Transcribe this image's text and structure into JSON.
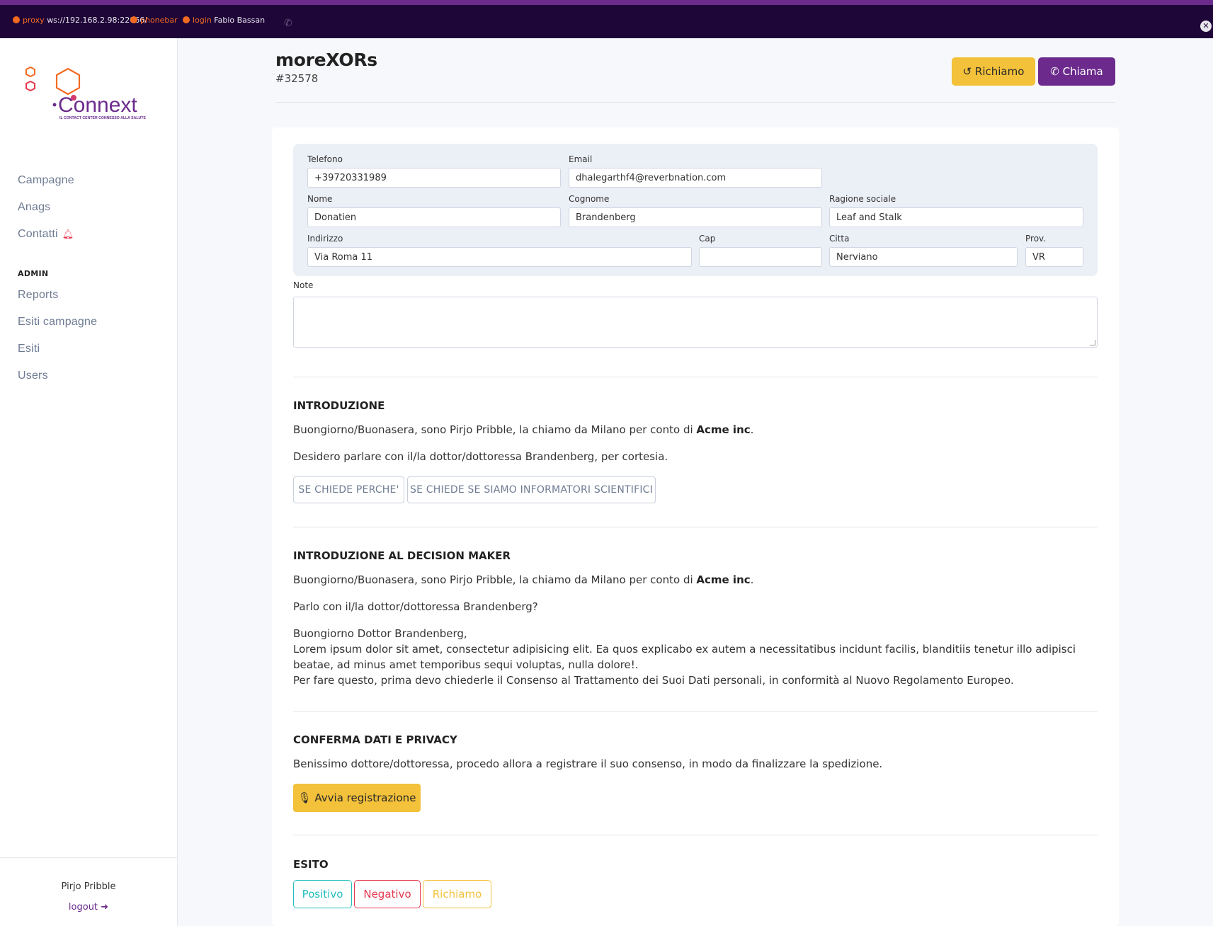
{
  "topbar": {
    "proxy_label": "proxy",
    "proxy_value": "ws://192.168.2.98:22066/",
    "phonebar_label": "phonebar",
    "login_label": "login",
    "login_user": "Fabio Bassan"
  },
  "logo": {
    "brand": "Connext",
    "tagline": "IL CONTACT CENTER CONNESSO ALLA SALUTE"
  },
  "sidebar": {
    "items": [
      {
        "label": "Campagne"
      },
      {
        "label": "Anags"
      },
      {
        "label": "Contatti"
      }
    ],
    "admin_heading": "ADMIN",
    "admin_items": [
      {
        "label": "Reports"
      },
      {
        "label": "Esiti campagne"
      },
      {
        "label": "Esiti"
      },
      {
        "label": "Users"
      }
    ],
    "user_name": "Pirjo Pribble",
    "logout_label": "logout"
  },
  "header": {
    "title": "moreXORs",
    "id": "#32578",
    "richiamo_label": "Richiamo",
    "chiama_label": "Chiama"
  },
  "form": {
    "telefono_label": "Telefono",
    "telefono_value": "+39720331989",
    "email_label": "Email",
    "email_value": "dhalegarthf4@reverbnation.com",
    "nome_label": "Nome",
    "nome_value": "Donatien",
    "cognome_label": "Cognome",
    "cognome_value": "Brandenberg",
    "ragione_label": "Ragione sociale",
    "ragione_value": "Leaf and Stalk",
    "indirizzo_label": "Indirizzo",
    "indirizzo_value": "Via Roma 11",
    "cap_label": "Cap",
    "cap_value": "",
    "citta_label": "Citta",
    "citta_value": "Nerviano",
    "prov_label": "Prov.",
    "prov_value": "VR",
    "note_label": "Note",
    "note_value": ""
  },
  "script": {
    "intro_title": "INTRODUZIONE",
    "intro_p1_pre": "Buongiorno/Buonasera, sono Pirjo Pribble, la chiamo da Milano per conto di ",
    "intro_p1_company": "Acme inc",
    "intro_p2": "Desidero parlare con il/la dottor/dottoressa Brandenberg, per cortesia.",
    "btn_perche": "SE CHIEDE PERCHE'",
    "btn_informatori": "SE CHIEDE SE SIAMO INFORMATORI SCIENTIFICI",
    "dm_title": "INTRODUZIONE AL DECISION MAKER",
    "dm_p1_pre": "Buongiorno/Buonasera, sono Pirjo Pribble, la chiamo da Milano per conto di ",
    "dm_p1_company": "Acme inc",
    "dm_p2": "Parlo con il/la dottor/dottoressa Brandenberg?",
    "dm_p3_l1": "Buongiorno Dottor Brandenberg,",
    "dm_p3_l2": "Lorem ipsum dolor sit amet, consectetur adipisicing elit. Ea quos explicabo ex autem a necessitatibus incidunt facilis, blanditiis tenetur illo adipisci",
    "dm_p3_l3": "beatae, ad minus amet temporibus sequi voluptas, nulla dolore!.",
    "dm_p3_l4": "Per fare questo, prima devo chiederle il Consenso al Trattamento dei Suoi Dati personali, in conformità al Nuovo Regolamento Europeo.",
    "privacy_title": "CONFERMA DATI E PRIVACY",
    "privacy_p1": "Benissimo dottore/dottoressa, procedo allora a registrare il suo consenso, in modo da finalizzare la spedizione.",
    "rec_btn": "Avvia registrazione",
    "esito_title": "ESITO",
    "esito_positivo": "Positivo",
    "esito_negativo": "Negativo",
    "esito_richiamo": "Richiamo"
  },
  "colors": {
    "brand_purple": "#6b2a8c",
    "accent_yellow": "#f3c13a",
    "positive": "#25bfbf",
    "negative": "#e53950",
    "status_orange": "#f26a21"
  }
}
